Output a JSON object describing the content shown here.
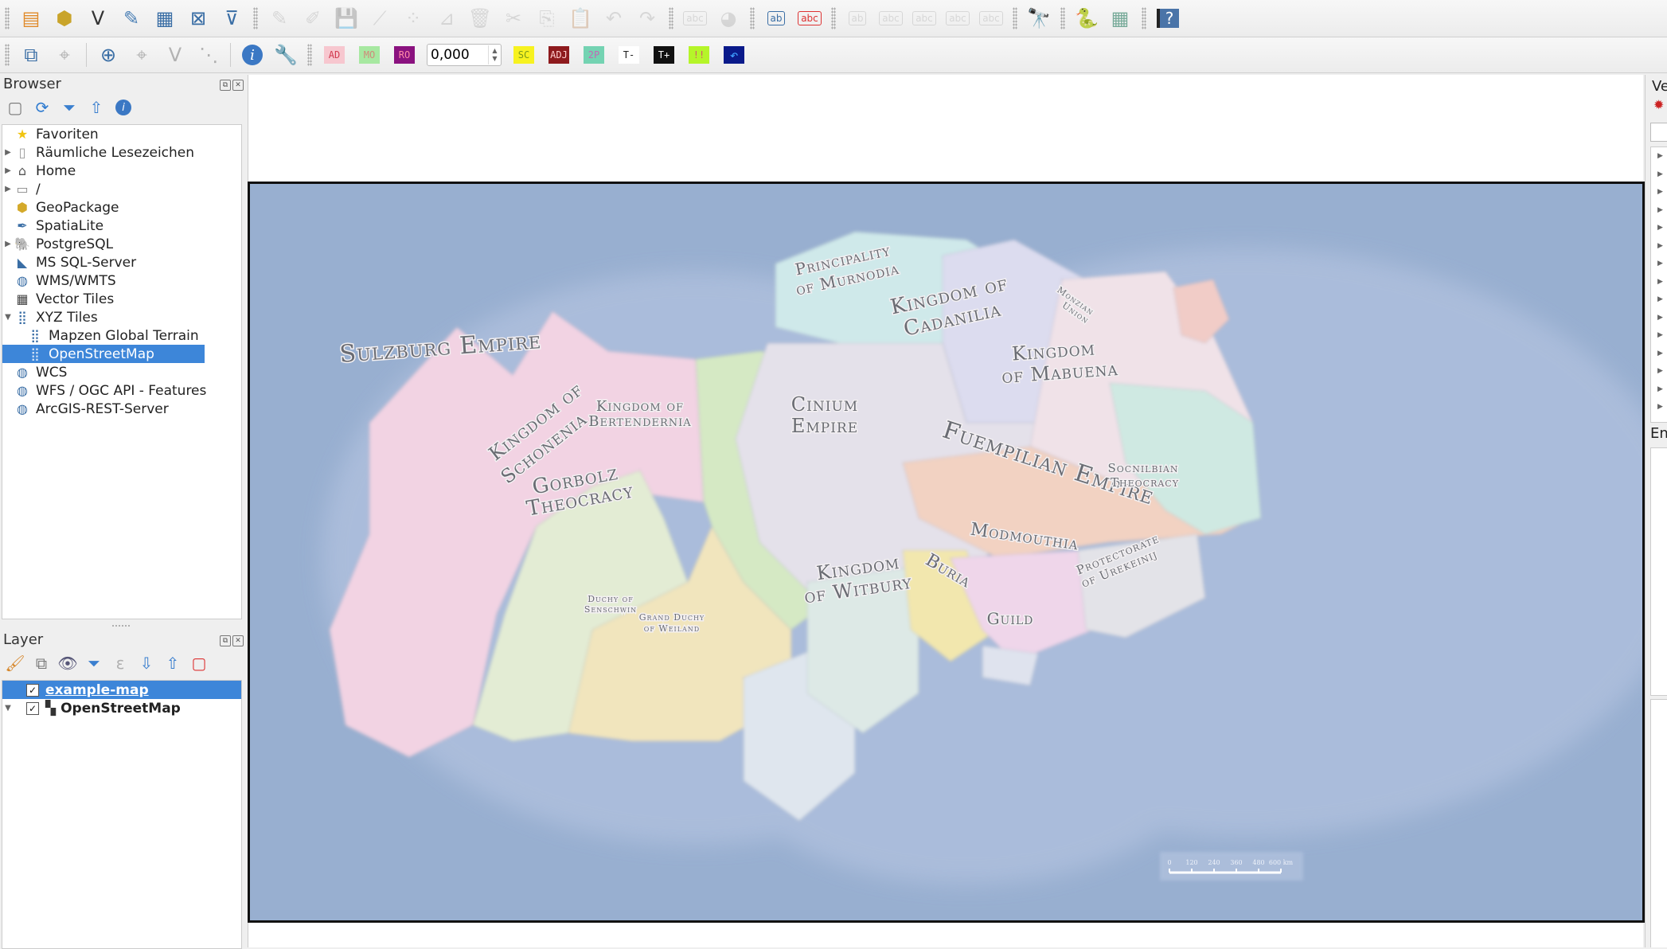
{
  "toolbar_top": {
    "groups": [
      [
        "new-project-icon",
        "new-geopackage-layer-icon",
        "new-shapefile-layer-icon",
        "new-spatialite-layer-icon",
        "new-temp-layer-icon",
        "new-virtual-layer-icon",
        "new-mesh-layer-icon"
      ],
      [
        "toggle-editing-icon",
        "current-edits-icon",
        "save-edits-icon",
        "digitize-icon",
        "vertex-tool-icon",
        "modify-attributes-icon",
        "delete-selected-icon",
        "cut-features-icon",
        "copy-features-icon",
        "paste-features-icon",
        "undo-icon",
        "redo-icon"
      ],
      [
        "label-toolbar-icon",
        "diagram-icon"
      ],
      [
        "layer-labeling-icon",
        "label-abc-icon"
      ],
      [
        "pin-labels-icon",
        "show-hide-labels-icon",
        "move-label-icon",
        "rotate-label-icon",
        "change-label-icon"
      ],
      [
        "nominatim-search-icon"
      ],
      [
        "python-console-icon",
        "plugins-grid-icon"
      ],
      [
        "help-icon"
      ]
    ]
  },
  "toolbar_second": {
    "badges": [
      {
        "name": "ad",
        "text": "AD",
        "bg": "#f7c7cf",
        "fg": "#d23a4f"
      },
      {
        "name": "mo",
        "text": "MO",
        "bg": "#a7e8a1",
        "fg": "#d08a7a"
      },
      {
        "name": "ro",
        "text": "RO",
        "bg": "#8a127f",
        "fg": "#ff8aa7"
      }
    ],
    "spin_value": "0,000",
    "badges2": [
      {
        "name": "sc",
        "text": "SC",
        "bg": "#f7f220",
        "fg": "#7a9a1a"
      },
      {
        "name": "adj",
        "text": "ADJ",
        "bg": "#8e1a1d",
        "fg": "#ffcfcf"
      },
      {
        "name": "2p",
        "text": "2P",
        "bg": "#74d3b2",
        "fg": "#c36ab4"
      },
      {
        "name": "t-minus",
        "text": "T-",
        "bg": "#ffffff",
        "fg": "#222222"
      },
      {
        "name": "t-plus",
        "text": "T+",
        "bg": "#111111",
        "fg": "#ffffff"
      },
      {
        "name": "warn",
        "text": "!!",
        "bg": "#b5f529",
        "fg": "#d25b6a"
      }
    ]
  },
  "browser": {
    "title": "Browser",
    "items": [
      {
        "label": "Favoriten",
        "icon": "star-icon",
        "expand": "",
        "indent": 0
      },
      {
        "label": "Räumliche Lesezeichen",
        "icon": "bookmark-icon",
        "expand": "▶",
        "indent": 0
      },
      {
        "label": "Home",
        "icon": "home-folder-icon",
        "expand": "▶",
        "indent": 0
      },
      {
        "label": "/",
        "icon": "folder-icon",
        "expand": "▶",
        "indent": 0
      },
      {
        "label": "GeoPackage",
        "icon": "geopackage-icon",
        "expand": "",
        "indent": 0
      },
      {
        "label": "SpatiaLite",
        "icon": "spatialite-feather-icon",
        "expand": "",
        "indent": 0
      },
      {
        "label": "PostgreSQL",
        "icon": "postgresql-elephant-icon",
        "expand": "▶",
        "indent": 0
      },
      {
        "label": "MS SQL-Server",
        "icon": "mssql-icon",
        "expand": "",
        "indent": 0
      },
      {
        "label": "WMS/WMTS",
        "icon": "wms-globe-icon",
        "expand": "",
        "indent": 0
      },
      {
        "label": "Vector Tiles",
        "icon": "vector-tiles-grid-icon",
        "expand": "",
        "indent": 0
      },
      {
        "label": "XYZ Tiles",
        "icon": "xyz-tiles-icon",
        "expand": "▼",
        "indent": 0
      },
      {
        "label": "Mapzen Global Terrain",
        "icon": "xyz-tiles-icon",
        "expand": "",
        "indent": 1
      },
      {
        "label": "OpenStreetMap",
        "icon": "xyz-tiles-icon",
        "expand": "",
        "indent": 1,
        "selected": true
      },
      {
        "label": "WCS",
        "icon": "wcs-globe-icon",
        "expand": "",
        "indent": 0
      },
      {
        "label": "WFS / OGC API - Features",
        "icon": "wfs-globe-icon",
        "expand": "",
        "indent": 0
      },
      {
        "label": "ArcGIS-REST-Server",
        "icon": "arcgis-globe-icon",
        "expand": "",
        "indent": 0
      }
    ]
  },
  "layers": {
    "title": "Layer",
    "items": [
      {
        "label": "example-map",
        "checked": true,
        "selected": true,
        "expand": ""
      },
      {
        "label": "OpenStreetMap",
        "checked": true,
        "selected": false,
        "expand": "▼"
      }
    ]
  },
  "right_dock": {
    "title_partial": "Ve",
    "title2_partial": "En"
  },
  "map": {
    "labels": [
      {
        "text": "Sulzburg Empire",
        "size": 30
      },
      {
        "text": "Kingdom of",
        "size": 24
      },
      {
        "text": "Schonenia",
        "size": 24
      },
      {
        "text": "Gorbolz",
        "size": 26
      },
      {
        "text": "Theocracy",
        "size": 26
      },
      {
        "text": "Kingdom of",
        "size": 18
      },
      {
        "text": "Bertendernia",
        "size": 18
      },
      {
        "text": "Principality",
        "size": 20
      },
      {
        "text": "of Murnodia",
        "size": 20
      },
      {
        "text": "Kingdom of",
        "size": 26
      },
      {
        "text": "Cadanilia",
        "size": 26
      },
      {
        "text": "Monzian",
        "size": 11
      },
      {
        "text": "Union",
        "size": 11
      },
      {
        "text": "Kingdom",
        "size": 24
      },
      {
        "text": "of Mabuena",
        "size": 24
      },
      {
        "text": "Cinium",
        "size": 24
      },
      {
        "text": "Empire",
        "size": 24
      },
      {
        "text": "Fuempilian Empire",
        "size": 30
      },
      {
        "text": "Socnilbian",
        "size": 15
      },
      {
        "text": "Theocracy",
        "size": 15
      },
      {
        "text": "Modmouthia",
        "size": 22
      },
      {
        "text": "Protectorate",
        "size": 15
      },
      {
        "text": "of Urekeinij",
        "size": 15
      },
      {
        "text": "Kingdom",
        "size": 24
      },
      {
        "text": "of Witbury",
        "size": 24
      },
      {
        "text": "Buria",
        "size": 22
      },
      {
        "text": "Guild",
        "size": 20
      },
      {
        "text": "Duchy of",
        "size": 11
      },
      {
        "text": "Senschwin",
        "size": 11
      },
      {
        "text": "Grand Duchy",
        "size": 11
      },
      {
        "text": "of Weiland",
        "size": 11
      }
    ],
    "scalebar": {
      "ticks": [
        "0",
        "120",
        "240",
        "360",
        "480",
        "600 km"
      ]
    },
    "colors": {
      "sea": "#98afd0",
      "shelf": "#aebfdd",
      "coast": "#bccbe6"
    }
  }
}
